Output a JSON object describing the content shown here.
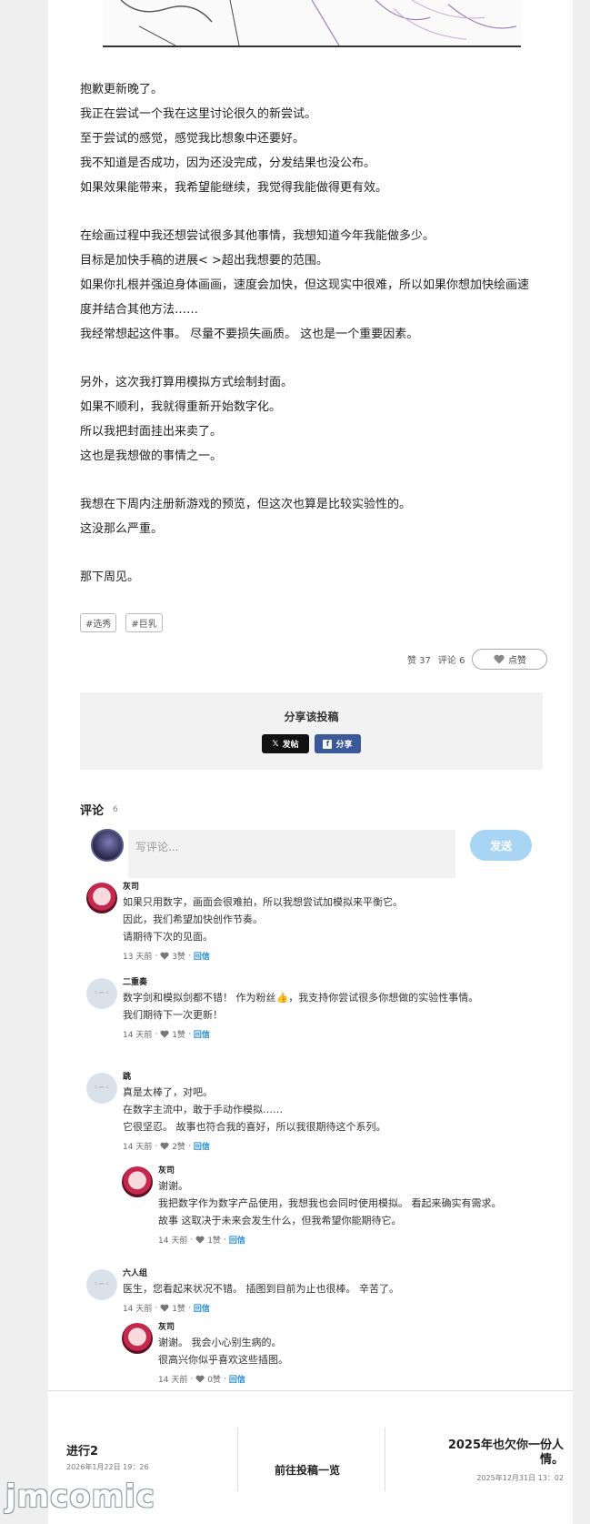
{
  "post": {
    "paragraphs": [
      [
        "抱歉更新晚了。",
        "我正在尝试一个我在这里讨论很久的新尝试。",
        "至于尝试的感觉，感觉我比想象中还要好。",
        "我不知道是否成功，因为还没完成，分发结果也没公布。",
        "如果效果能带来，我希望能继续，我觉得我能做得更有效。"
      ],
      [
        "在绘画过程中我还想尝试很多其他事情，我想知道今年我能做多少。",
        "目标是加快手稿的进展< >超出我想要的范围。",
        "如果你扎根并强迫身体画画，速度会加快，但这现实中很难，所以如果你想加快绘画速",
        "度并结合其他方法……",
        "我经常想起这件事。 尽量不要损失画质。 这也是一个重要因素。"
      ],
      [
        "另外，这次我打算用模拟方式绘制封面。",
        "如果不顺利，我就得重新开始数字化。",
        "所以我把封面挂出来卖了。",
        "这也是我想做的事情之一。"
      ],
      [
        "我想在下周内注册新游戏的预览，但这次也算是比较实验性的。",
        "这没那么严重。"
      ],
      [
        "那下周见。"
      ]
    ],
    "tags": [
      "#选秀",
      "#巨乳"
    ],
    "likes": "赞 37",
    "comments_count": "评论 6",
    "like_button": "点赞"
  },
  "share": {
    "title": "分享该投稿",
    "x_label": "发帖",
    "fb_label": "分享"
  },
  "comments": {
    "heading": "评论",
    "count": "6",
    "placeholder": "写评论...",
    "send_label": "发送",
    "items": [
      {
        "name": "灰司",
        "lines": [
          "如果只用数字，画面会很难拍，所以我想尝试加模拟来平衡它。",
          "因此，我们希望加快创作节奏。",
          "请期待下次的见面。"
        ],
        "time": "13 天前",
        "likes": "3赞",
        "reply": "回信"
      },
      {
        "name": "二重奏",
        "lines": [
          "数字剑和模拟剑都不错！ 作为粉丝👍，我支持你尝试很多你想做的实验性事情。",
          "我们期待下一次更新！"
        ],
        "time": "14 天前",
        "likes": "1赞",
        "reply": "回信"
      },
      {
        "name": "跳",
        "lines": [
          "真是太棒了，对吧。",
          "在数字主流中，敢于手动作模拟……",
          "它很坚忍。 故事也符合我的喜好，所以我很期待这个系列。"
        ],
        "time": "14 天前",
        "likes": "2赞",
        "reply": "回信"
      },
      {
        "name": "灰司",
        "lines": [
          "谢谢。",
          "我把数字作为数字产品使用，我想我也会同时使用模拟。 看起来确实有需求。",
          "故事 这取决于未来会发生什么，但我希望你能期待它。"
        ],
        "time": "14 天前",
        "likes": "1赞",
        "reply": "回信"
      },
      {
        "name": "六人组",
        "lines": [
          "医生，您看起来状况不错。 插图到目前为止也很棒。 辛苦了。"
        ],
        "time": "14 天前",
        "likes": "1赞",
        "reply": "回信"
      },
      {
        "name": "灰司",
        "lines": [
          "谢谢。 我会小心别生病的。",
          "很高兴你似乎喜欢这些插图。"
        ],
        "time": "14 天前",
        "likes": "0赞",
        "reply": "回信"
      }
    ]
  },
  "nav": {
    "prev_title": "进行2",
    "prev_date": "2026年1月22日 19：26",
    "list_label": "前往投稿一览",
    "next_title_1": "2025年也欠你一份人",
    "next_title_2": "情。",
    "next_date": "2025年12月31日 13：02"
  },
  "watermark": "jmcomic"
}
